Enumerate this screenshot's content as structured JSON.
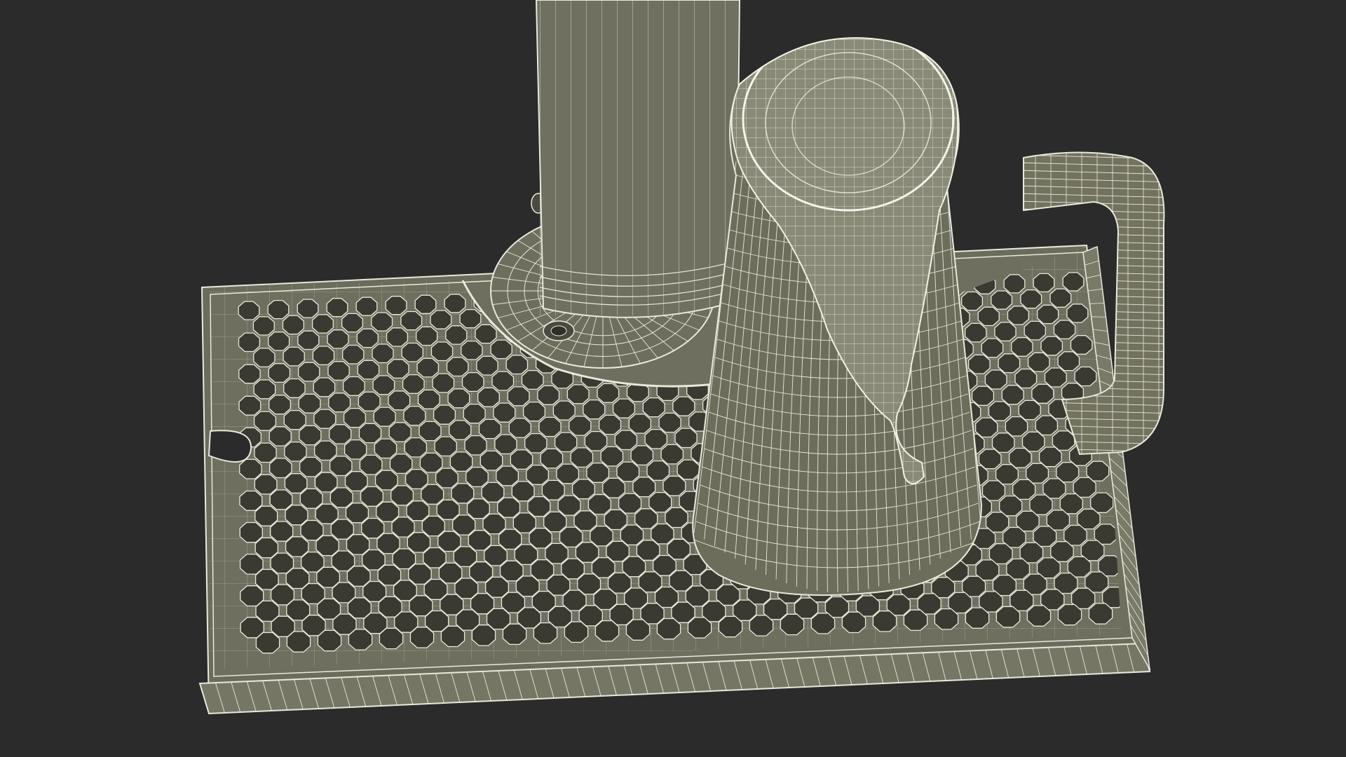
{
  "scene": {
    "background": "#2b2b2b",
    "mesh_fill": "#70705f",
    "mesh_fill_dark": "#5c5c4d",
    "hole_fill": "#3a3a32",
    "wire_color": "#e9e9dc",
    "wire_color_dim": "#c8c8b8"
  },
  "objects": [
    {
      "name": "drip-tray",
      "icon": "wireframe-drip-tray"
    },
    {
      "name": "tap-tower",
      "icon": "wireframe-beer-tower"
    },
    {
      "name": "beer-mug",
      "icon": "wireframe-beer-mug"
    }
  ]
}
